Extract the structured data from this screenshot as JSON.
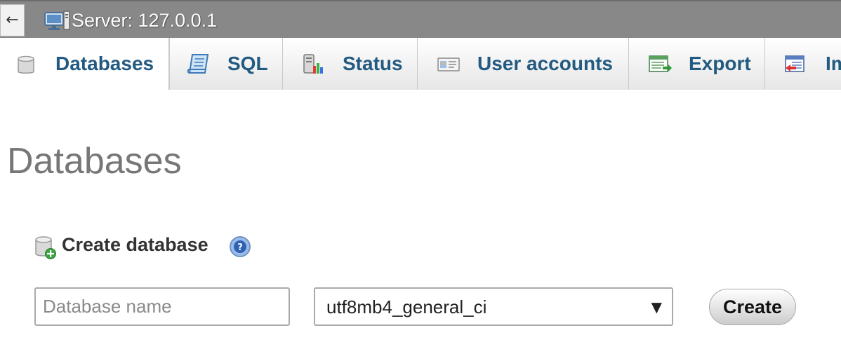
{
  "topbar": {
    "back_icon": "←",
    "server_icon": "server-icon",
    "server_label": "Server: 127.0.0.1"
  },
  "tabs": [
    {
      "label": "Databases",
      "icon": "database-icon",
      "active": true
    },
    {
      "label": "SQL",
      "icon": "sql-scroll-icon",
      "active": false
    },
    {
      "label": "Status",
      "icon": "status-chart-icon",
      "active": false
    },
    {
      "label": "User accounts",
      "icon": "user-accounts-icon",
      "active": false
    },
    {
      "label": "Export",
      "icon": "export-icon",
      "active": false
    },
    {
      "label": "Import",
      "icon": "import-icon",
      "active": false
    }
  ],
  "main": {
    "title": "Databases",
    "create_section": {
      "heading": "Create database",
      "icon": "create-database-icon",
      "help_icon": "help-icon",
      "name_input": {
        "value": "",
        "placeholder": "Database name"
      },
      "collation": {
        "selected": "utf8mb4_general_ci",
        "arrow": "▼"
      },
      "create_button": "Create"
    }
  },
  "colors": {
    "topbar_bg": "#888888",
    "tab_link": "#235a81",
    "title_gray": "#777777"
  }
}
